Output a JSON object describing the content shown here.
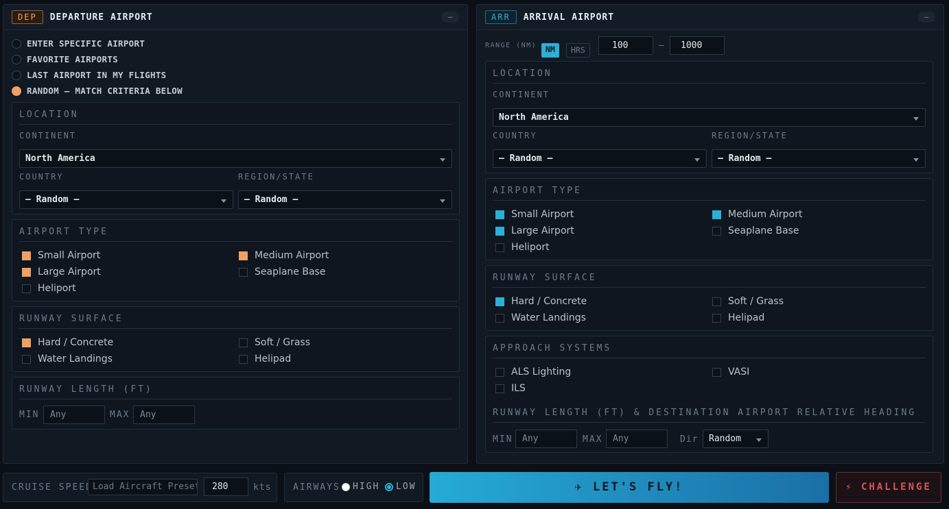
{
  "departure": {
    "tag": "DEP",
    "title": "DEPARTURE AIRPORT",
    "collapse": "–",
    "options": [
      {
        "label": "ENTER SPECIFIC AIRPORT",
        "selected": false
      },
      {
        "label": "FAVORITE AIRPORTS",
        "selected": false
      },
      {
        "label": "LAST AIRPORT IN MY FLIGHTS",
        "selected": false
      },
      {
        "label": "RANDOM — MATCH CRITERIA BELOW",
        "selected": true
      }
    ],
    "location": {
      "title": "LOCATION",
      "continent_label": "CONTINENT",
      "continent": "North America",
      "country_label": "COUNTRY",
      "country": "– Random –",
      "region_label": "REGION/STATE",
      "region": "– Random –"
    },
    "airport_type": {
      "title": "AIRPORT TYPE",
      "small": "Small Airport",
      "medium": "Medium Airport",
      "large": "Large Airport",
      "seaplane": "Seaplane Base",
      "heliport": "Heliport"
    },
    "runway_surface": {
      "title": "RUNWAY SURFACE",
      "hard": "Hard / Concrete",
      "soft": "Soft / Grass",
      "water": "Water Landings",
      "helipad": "Helipad"
    },
    "runway_length": {
      "title": "RUNWAY LENGTH (FT)",
      "min_label": "MIN",
      "min_placeholder": "Any",
      "max_label": "MAX",
      "max_placeholder": "Any"
    }
  },
  "arrival": {
    "tag": "ARR",
    "title": "ARRIVAL AIRPORT",
    "collapse": "–",
    "range_label": "RANGE (NM)",
    "unit_nm": "NM",
    "unit_hrs": "HRS",
    "range_min": "100",
    "range_sep": "–",
    "range_max": "1000",
    "location": {
      "title": "LOCATION",
      "continent_label": "CONTINENT",
      "continent": "North America",
      "country_label": "COUNTRY",
      "country": "– Random –",
      "region_label": "REGION/STATE",
      "region": "– Random –"
    },
    "airport_type": {
      "title": "AIRPORT TYPE",
      "small": "Small Airport",
      "medium": "Medium Airport",
      "large": "Large Airport",
      "seaplane": "Seaplane Base",
      "heliport": "Heliport"
    },
    "runway_surface": {
      "title": "RUNWAY SURFACE",
      "hard": "Hard / Concrete",
      "soft": "Soft / Grass",
      "water": "Water Landings",
      "helipad": "Helipad"
    },
    "approach": {
      "title": "APPROACH SYSTEMS",
      "als": "ALS Lighting",
      "vasi": "VASI",
      "ils": "ILS"
    },
    "runway_length": {
      "title": "RUNWAY LENGTH (FT) & DESTINATION AIRPORT RELATIVE HEADING",
      "min_label": "MIN",
      "min_placeholder": "Any",
      "max_label": "MAX",
      "max_placeholder": "Any",
      "dir_label": "Dir",
      "dir_value": "Random"
    }
  },
  "footer": {
    "cruise_label": "CRUISE SPEED",
    "preset_placeholder": "Load Aircraft Presets",
    "speed": "280",
    "speed_unit": "kts",
    "airways_label": "AIRWAYS",
    "high": "HIGH",
    "low": "LOW",
    "fly": "✈ LET'S FLY!",
    "challenge": "⚡ CHALLENGE"
  },
  "colors": {
    "departure_accent": "#f0a064",
    "arrival_accent": "#2cb0d6",
    "challenge": "#d9565a"
  }
}
